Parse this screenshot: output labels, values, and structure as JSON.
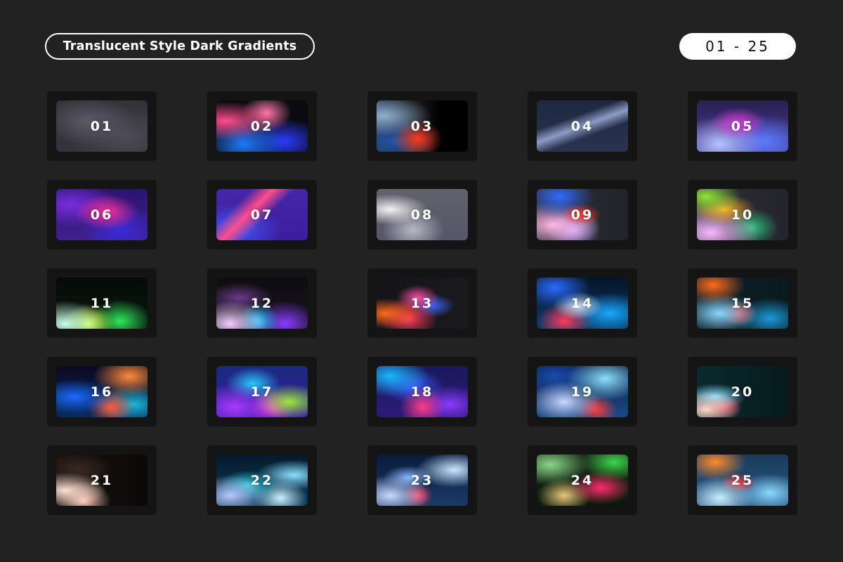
{
  "header": {
    "title": "Translucent Style Dark Gradients",
    "range": "01 - 25"
  },
  "swatches": [
    {
      "label": "01"
    },
    {
      "label": "02"
    },
    {
      "label": "03"
    },
    {
      "label": "04"
    },
    {
      "label": "05"
    },
    {
      "label": "06"
    },
    {
      "label": "07"
    },
    {
      "label": "08"
    },
    {
      "label": "09"
    },
    {
      "label": "10"
    },
    {
      "label": "11"
    },
    {
      "label": "12"
    },
    {
      "label": "13"
    },
    {
      "label": "14"
    },
    {
      "label": "15"
    },
    {
      "label": "16"
    },
    {
      "label": "17"
    },
    {
      "label": "18"
    },
    {
      "label": "19"
    },
    {
      "label": "20"
    },
    {
      "label": "21"
    },
    {
      "label": "22"
    },
    {
      "label": "23"
    },
    {
      "label": "24"
    },
    {
      "label": "25"
    }
  ],
  "colors": {
    "background": "#222222",
    "card": "#141414",
    "pill_fill": "#ffffff",
    "text": "#ffffff"
  }
}
